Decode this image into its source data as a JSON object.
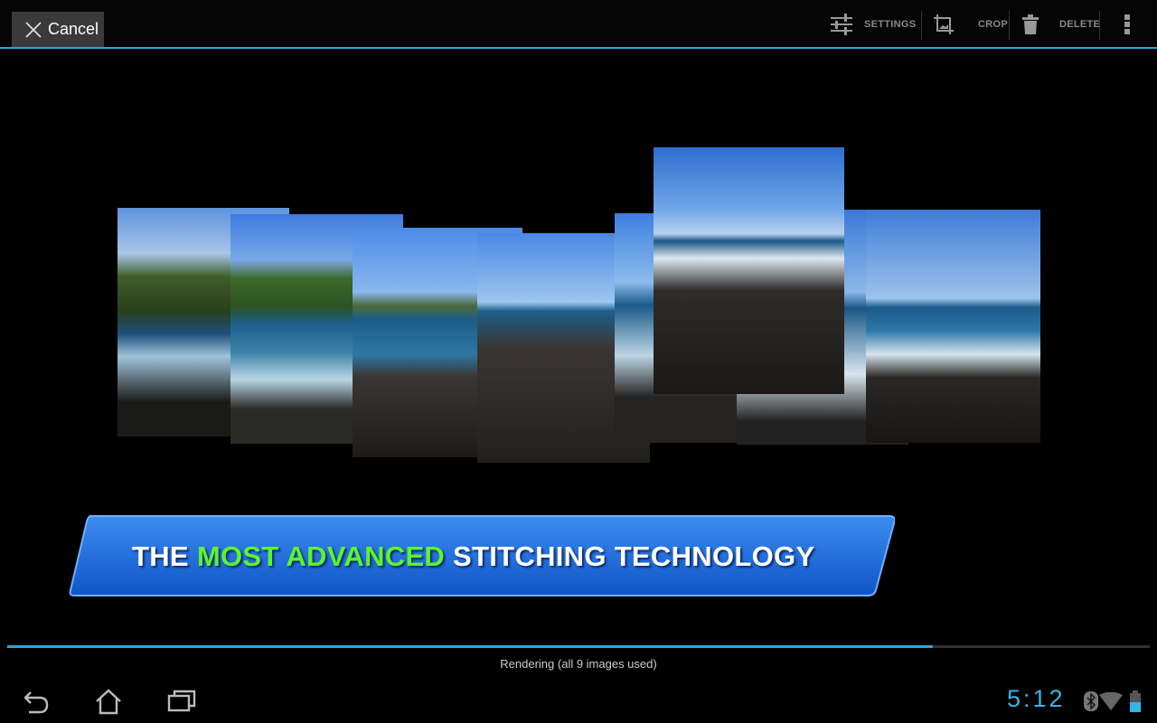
{
  "topbar": {
    "cancel_label": "Cancel",
    "actions": [
      {
        "label": "SETTINGS",
        "icon": "sliders-icon"
      },
      {
        "label": "CROP",
        "icon": "crop-icon"
      },
      {
        "label": "DELETE",
        "icon": "trash-icon"
      }
    ],
    "overflow_icon": "overflow-menu-icon"
  },
  "banner": {
    "pre": "THE ",
    "highlight": "MOST ADVANCED",
    "post": " STITCHING TECHNOLOGY"
  },
  "progress": {
    "percent": 81,
    "status": "Rendering (all 9 images used)"
  },
  "system": {
    "time": "5:12",
    "icons": [
      "back-icon",
      "home-icon",
      "recent-apps-icon",
      "bluetooth-icon",
      "wifi-icon",
      "battery-icon"
    ]
  },
  "colors": {
    "accent": "#2aa5d8",
    "highlight": "#5cf52c",
    "banner": "#1f6fe0"
  }
}
